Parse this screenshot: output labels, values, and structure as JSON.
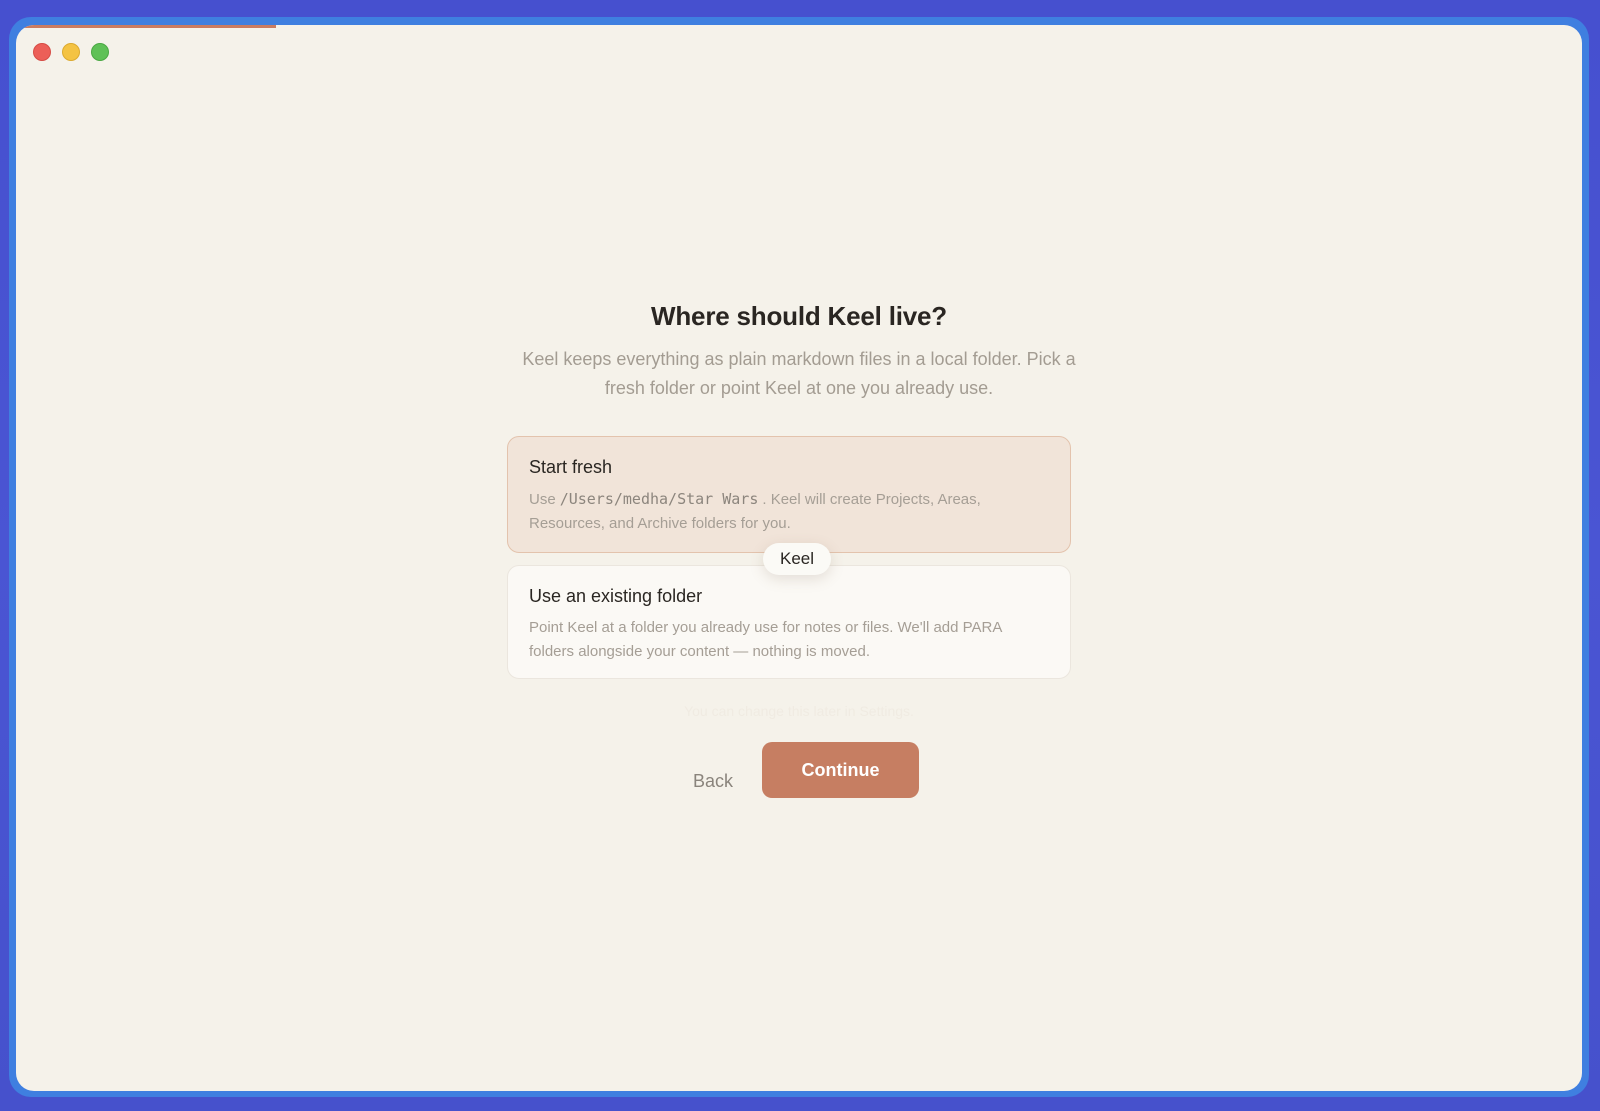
{
  "window": {
    "progress_fraction": 0.166,
    "accent_color": "#c97c61"
  },
  "onboarding": {
    "title": "Where should Keel live?",
    "subtitle": "Keel keeps everything as plain markdown files in a local folder. Pick a fresh folder or point Keel at one you already use.",
    "options": [
      {
        "title": "Start fresh",
        "desc_prefix": "Use",
        "path": "/Users/medha/Star Wars",
        "desc_suffix": ". Keel will create Projects, Areas, Resources, and Archive folders for you.",
        "selected": true
      },
      {
        "title": "Use an existing folder",
        "desc": "Point Keel at a folder you already use for notes or files. We'll add PARA folders alongside your content — nothing is moved.",
        "selected": false
      }
    ],
    "tooltip": "Keel",
    "note": "You can change this later in Settings.",
    "back_label": "Back",
    "continue_label": "Continue"
  }
}
